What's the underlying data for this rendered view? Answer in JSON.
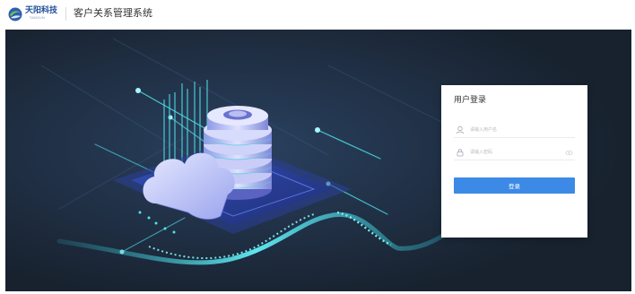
{
  "header": {
    "brand_name": "天阳科技",
    "brand_sub": "TANSUN",
    "system_title": "客户关系管理系统"
  },
  "login": {
    "title": "用户登录",
    "username_placeholder": "请输入用户名",
    "password_placeholder": "请输入密码",
    "submit_label": "登录"
  },
  "colors": {
    "brand": "#1e4e9a",
    "accent": "#3d8ae6",
    "hero_bg": "#1a2638",
    "glow": "#3fe0ea"
  },
  "icons": {
    "logo": "tansun-logo-icon",
    "username": "user-icon",
    "password": "lock-icon",
    "toggle_password": "eye-icon"
  }
}
